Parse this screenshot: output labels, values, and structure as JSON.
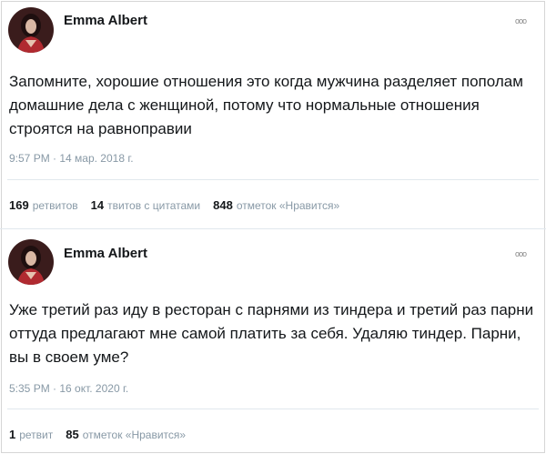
{
  "tweets": [
    {
      "author": "Emma Albert",
      "more_icon": "ooo",
      "text": "Запомните, хорошие отношения это когда мужчина разделяет пополам домашние дела с женщиной, потому что нормальные отношения строятся на равноправии",
      "timestamp": "9:57 PM · 14 мар. 2018 г.",
      "stats": [
        {
          "count": "169",
          "label": "ретвитов"
        },
        {
          "count": "14",
          "label": "твитов с цитатами"
        },
        {
          "count": "848",
          "label": "отметок «Нравится»"
        }
      ]
    },
    {
      "author": "Emma Albert",
      "more_icon": "ooo",
      "text": "Уже третий раз иду в ресторан с парнями из тиндера и третий раз парни оттуда предлагают мне самой платить за себя. Удаляю тиндер. Парни, вы в своем уме?",
      "timestamp": "5:35 PM · 16 окт. 2020 г.",
      "stats": [
        {
          "count": "1",
          "label": "ретвит"
        },
        {
          "count": "85",
          "label": "отметок «Нравится»"
        }
      ]
    }
  ],
  "colors": {
    "text": "#14171a",
    "meta": "#8899a6",
    "divider": "#e1e8ed"
  }
}
